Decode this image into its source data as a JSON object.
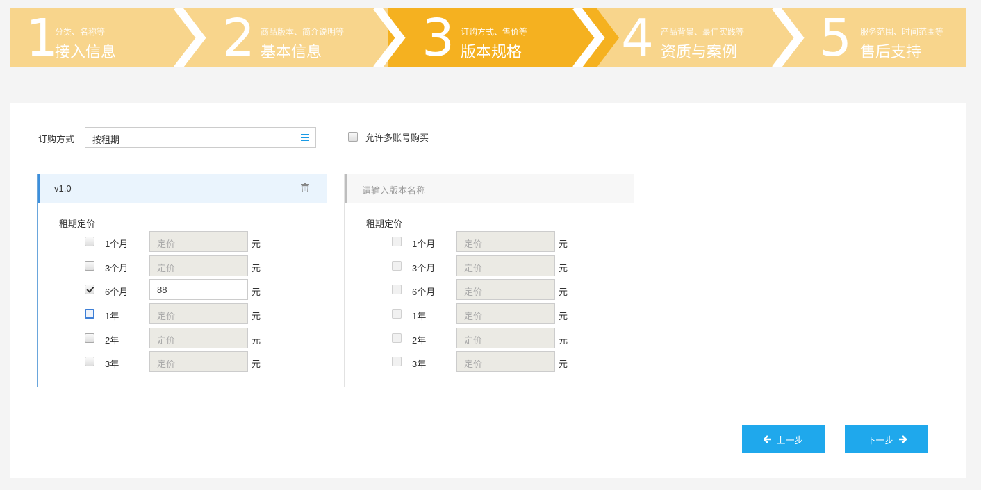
{
  "colors": {
    "step_inactive": "#f8d58c",
    "step_active": "#f5b120",
    "accent_blue": "#1fa8ec",
    "panel_bg": "#ffffff",
    "page_bg": "#f4f4f4"
  },
  "steps": [
    {
      "num": "1",
      "sub": "分类、名称等",
      "title": "接入信息",
      "active": false
    },
    {
      "num": "2",
      "sub": "商品版本、简介说明等",
      "title": "基本信息",
      "active": false
    },
    {
      "num": "3",
      "sub": "订购方式、售价等",
      "title": "版本规格",
      "active": true
    },
    {
      "num": "4",
      "sub": "产品背景、最佳实践等",
      "title": "资质与案例",
      "active": false
    },
    {
      "num": "5",
      "sub": "服务范围、时间范围等",
      "title": "售后支持",
      "active": false
    }
  ],
  "order": {
    "label": "订购方式",
    "value": "按租期",
    "multi_account_label": "允许多账号购买",
    "multi_account_checked": false
  },
  "versions": [
    {
      "name": "v1.0",
      "placeholder": "",
      "price_label": "租期定价",
      "rows": [
        {
          "period": "1个月",
          "checked": false,
          "value": "",
          "placeholder": "定价",
          "unit": "元"
        },
        {
          "period": "3个月",
          "checked": false,
          "value": "",
          "placeholder": "定价",
          "unit": "元"
        },
        {
          "period": "6个月",
          "checked": true,
          "value": "88",
          "placeholder": "定价",
          "unit": "元"
        },
        {
          "period": "1年",
          "checked": false,
          "value": "",
          "placeholder": "定价",
          "unit": "元"
        },
        {
          "period": "2年",
          "checked": false,
          "value": "",
          "placeholder": "定价",
          "unit": "元"
        },
        {
          "period": "3年",
          "checked": false,
          "value": "",
          "placeholder": "定价",
          "unit": "元"
        }
      ]
    },
    {
      "name": "",
      "placeholder": "请输入版本名称",
      "price_label": "租期定价",
      "rows": [
        {
          "period": "1个月",
          "checked": false,
          "value": "",
          "placeholder": "定价",
          "unit": "元"
        },
        {
          "period": "3个月",
          "checked": false,
          "value": "",
          "placeholder": "定价",
          "unit": "元"
        },
        {
          "period": "6个月",
          "checked": false,
          "value": "",
          "placeholder": "定价",
          "unit": "元"
        },
        {
          "period": "1年",
          "checked": false,
          "value": "",
          "placeholder": "定价",
          "unit": "元"
        },
        {
          "period": "2年",
          "checked": false,
          "value": "",
          "placeholder": "定价",
          "unit": "元"
        },
        {
          "period": "3年",
          "checked": false,
          "value": "",
          "placeholder": "定价",
          "unit": "元"
        }
      ]
    }
  ],
  "nav": {
    "prev_label": "上一步",
    "next_label": "下一步"
  }
}
